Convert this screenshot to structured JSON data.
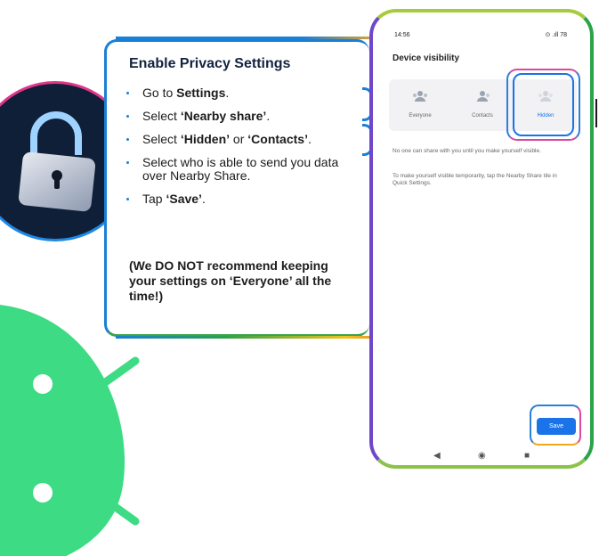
{
  "card": {
    "title": "Enable Privacy Settings",
    "steps": [
      {
        "pre": "Go to ",
        "bold": "Settings",
        "post": "."
      },
      {
        "pre": "Select ",
        "bold": "‘Nearby share’",
        "post": "."
      },
      {
        "pre": "Select ",
        "bold": "‘Hidden’",
        "mid": " or ",
        "bold2": "‘Contacts’",
        "post": "."
      },
      {
        "pre": "Select who is able to send you data over Nearby Share.",
        "bold": "",
        "post": ""
      },
      {
        "pre": "Tap ",
        "bold": "‘Save’",
        "post": "."
      }
    ],
    "warning": "(We DO NOT recommend keeping your settings on ‘Everyone’ all the time!)"
  },
  "phone": {
    "time": "14:56",
    "status_right": "⊙ .ıll 78",
    "title": "Device visibility",
    "options": [
      {
        "label": "Everyone",
        "selected": false
      },
      {
        "label": "Contacts",
        "selected": false
      },
      {
        "label": "Hidden",
        "selected": true
      }
    ],
    "desc1": "No one can share with you until you make yourself visible.",
    "desc2": "To make yourself visible temporarily, tap the Nearby Share tile in Quick Settings.",
    "save_label": "Save",
    "nav": [
      "back-icon",
      "home-icon",
      "recents-icon"
    ]
  },
  "colors": {
    "android_green": "#3ddc84",
    "accent_blue": "#1a73e8",
    "navy": "#0f1f38"
  }
}
